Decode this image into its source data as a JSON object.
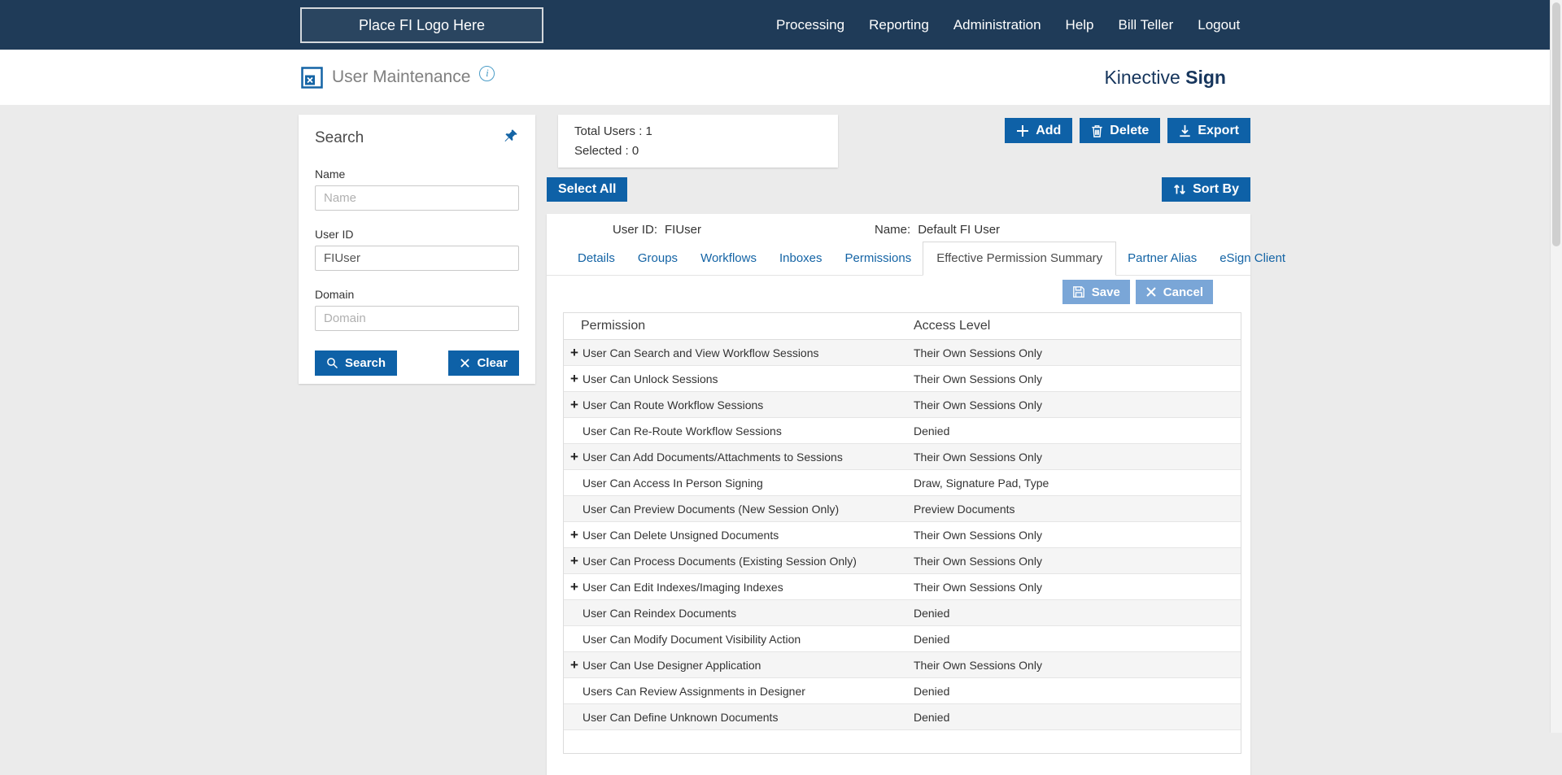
{
  "colors": {
    "topbar_bg": "#1f3b58",
    "primary_button_blue": "#0e61a7",
    "light_button_blue": "#7aa6d7",
    "link_blue": "#1464a5",
    "brand_navy": "#16355c"
  },
  "icons": {
    "info_glyph": "i"
  },
  "topbar": {
    "logo_placeholder": "Place FI Logo Here",
    "nav_items": [
      "Processing",
      "Reporting",
      "Administration",
      "Help",
      "Bill Teller",
      "Logout"
    ]
  },
  "header": {
    "title": "User Maintenance",
    "brand_regular": "Kinective",
    "brand_bold": "Sign"
  },
  "search_panel": {
    "title": "Search",
    "name_label": "Name",
    "name_placeholder": "Name",
    "userid_label": "User ID",
    "userid_value": "FIUser",
    "domain_label": "Domain",
    "domain_placeholder": "Domain",
    "search_button": "Search",
    "clear_button": "Clear"
  },
  "summary": {
    "total_users": "Total Users : 1",
    "selected": "Selected : 0"
  },
  "toolbar": {
    "add": "Add",
    "delete": "Delete",
    "export": "Export"
  },
  "list_controls": {
    "select_all": "Select All",
    "sort_by": "Sort By"
  },
  "user_detail": {
    "user_id_label": "User ID:",
    "user_id_value": "FIUser",
    "name_label": "Name:",
    "name_value": "Default FI User",
    "tabs": [
      {
        "label": "Details",
        "active": false
      },
      {
        "label": "Groups",
        "active": false
      },
      {
        "label": "Workflows",
        "active": false
      },
      {
        "label": "Inboxes",
        "active": false
      },
      {
        "label": "Permissions",
        "active": false
      },
      {
        "label": "Effective Permission Summary",
        "active": true
      },
      {
        "label": "Partner Alias",
        "active": false
      },
      {
        "label": "eSign Client",
        "active": false
      }
    ],
    "save_button": "Save",
    "cancel_button": "Cancel"
  },
  "permissions_table": {
    "expand_glyph": "+",
    "headers": {
      "permission": "Permission",
      "access_level": "Access Level"
    },
    "rows": [
      {
        "expandable": true,
        "permission": "User Can Search and View Workflow Sessions",
        "access_level": "Their Own Sessions Only"
      },
      {
        "expandable": true,
        "permission": "User Can Unlock Sessions",
        "access_level": "Their Own Sessions Only"
      },
      {
        "expandable": true,
        "permission": "User Can Route Workflow Sessions",
        "access_level": "Their Own Sessions Only"
      },
      {
        "expandable": false,
        "permission": "User Can Re-Route Workflow Sessions",
        "access_level": "Denied"
      },
      {
        "expandable": true,
        "permission": "User Can Add Documents/Attachments to Sessions",
        "access_level": "Their Own Sessions Only"
      },
      {
        "expandable": false,
        "permission": "User Can Access In Person Signing",
        "access_level": "Draw, Signature Pad, Type"
      },
      {
        "expandable": false,
        "permission": "User Can Preview Documents (New Session Only)",
        "access_level": "Preview Documents"
      },
      {
        "expandable": true,
        "permission": "User Can Delete Unsigned Documents",
        "access_level": "Their Own Sessions Only"
      },
      {
        "expandable": true,
        "permission": "User Can Process Documents (Existing Session Only)",
        "access_level": "Their Own Sessions Only"
      },
      {
        "expandable": true,
        "permission": "User Can Edit Indexes/Imaging Indexes",
        "access_level": "Their Own Sessions Only"
      },
      {
        "expandable": false,
        "permission": "User Can Reindex Documents",
        "access_level": "Denied"
      },
      {
        "expandable": false,
        "permission": "User Can Modify Document Visibility Action",
        "access_level": "Denied"
      },
      {
        "expandable": true,
        "permission": "User Can Use Designer Application",
        "access_level": "Their Own Sessions Only"
      },
      {
        "expandable": false,
        "permission": "Users Can Review Assignments in Designer",
        "access_level": "Denied"
      },
      {
        "expandable": false,
        "permission": "User Can Define Unknown Documents",
        "access_level": "Denied"
      }
    ]
  }
}
